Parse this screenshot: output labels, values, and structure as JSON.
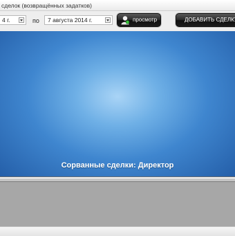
{
  "window": {
    "title": "сделок (возвращённых задатков)"
  },
  "filter": {
    "date_from": "4 г.",
    "to_label": "по",
    "date_to": "7 августа 2014 г."
  },
  "toolbar": {
    "view_label": "просмотр",
    "add_deal_label": "ДОБАВИТЬ СДЕЛКУ"
  },
  "banner": {
    "title": "Сорванные сделки: Директор",
    "colors": {
      "center": "#a9d4f6",
      "edge": "#245ea8"
    }
  }
}
